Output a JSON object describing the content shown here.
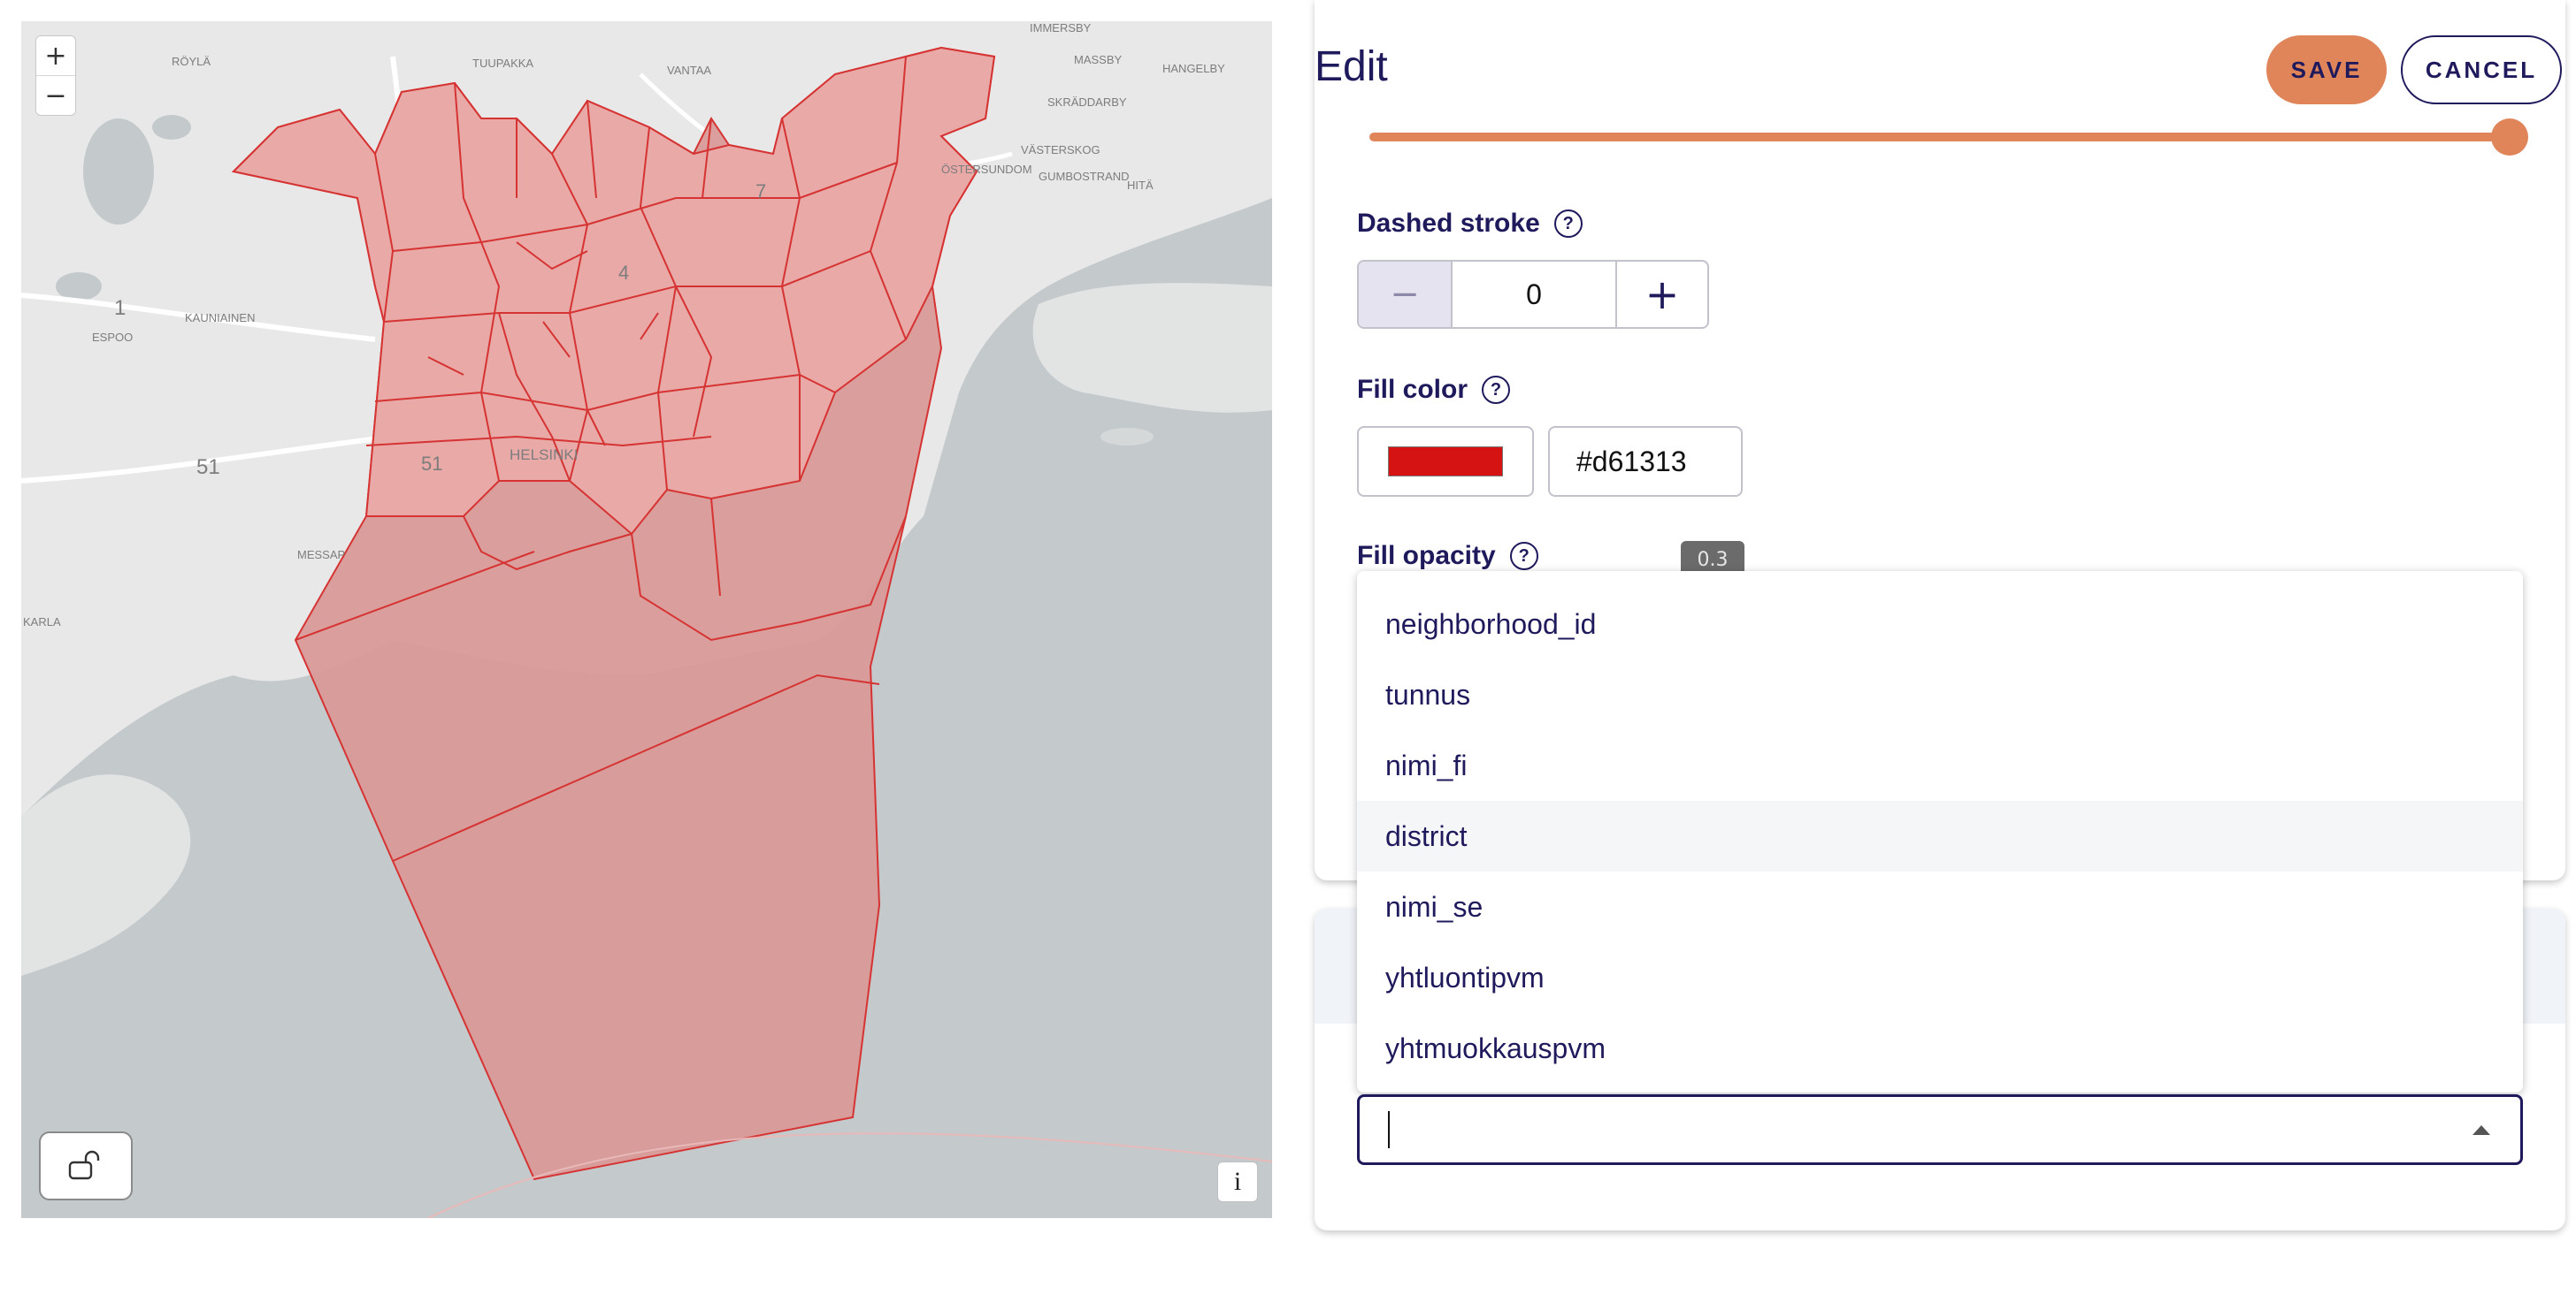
{
  "map": {
    "zoom_in": "+",
    "zoom_out": "−",
    "info": "i",
    "labels": [
      "RÖYLÄ",
      "TUUPAKKA",
      "VANTAA",
      "IMMERSBY",
      "MASSBY",
      "HANGELBY",
      "SKRÄDDARBY",
      "ÖSTERSUNDOM",
      "VÄSTERSKOG",
      "GUMBOSTRAND",
      "HITÄ",
      "1",
      "KAUNIAINEN",
      "ESPOO",
      "51",
      "51",
      "HELSINKI",
      "4",
      "7",
      "MESSAP",
      "KARLA"
    ],
    "fill_color": "#d61313",
    "fill_opacity": 0.3
  },
  "panel": {
    "title": "Edit",
    "save_label": "SAVE",
    "cancel_label": "CANCEL",
    "dashed_stroke": {
      "label": "Dashed stroke",
      "value": "0",
      "minus": "−",
      "plus": "+"
    },
    "fill_color": {
      "label": "Fill color",
      "value": "#d61313"
    },
    "fill_opacity": {
      "label": "Fill opacity",
      "value": "0.3"
    },
    "help_glyph": "?",
    "dropdown_options": [
      "neighborhood_id",
      "tunnus",
      "nimi_fi",
      "district",
      "nimi_se",
      "yhtluontipvm",
      "yhtmuokkauspvm"
    ],
    "highlighted_option": "district",
    "select_value": ""
  },
  "colors": {
    "accent": "#e0845a",
    "text": "#1f1a5c"
  }
}
